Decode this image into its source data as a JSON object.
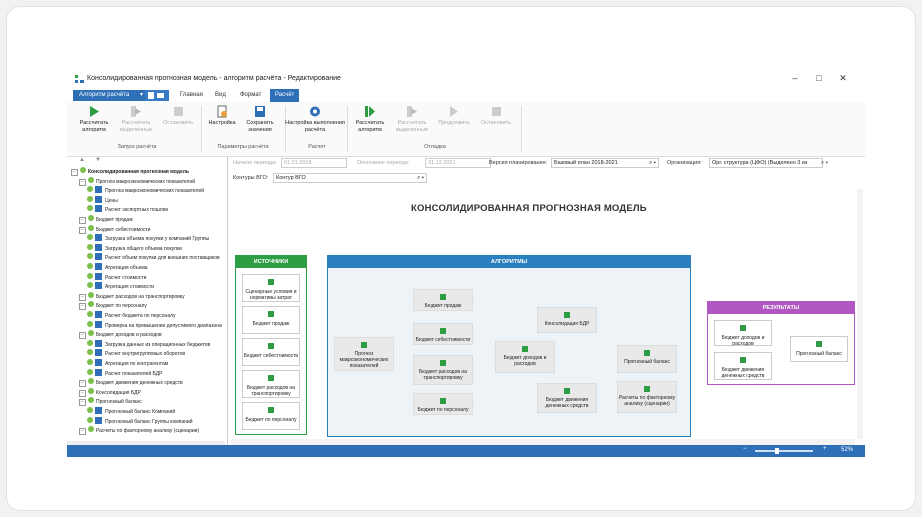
{
  "window": {
    "title": "Консолидированная прогнозная модель - алгоритм расчёта - Редактирование",
    "controls": [
      "–",
      "□",
      "✕"
    ]
  },
  "tabs": {
    "app_button": "Алгоритм расчёта",
    "items": [
      "Главная",
      "Вид",
      "Формат",
      "Расчёт"
    ],
    "active": "Расчёт"
  },
  "ribbon": {
    "buttons": [
      {
        "label": "Рассчитать алгоритм",
        "icon": "play-icon",
        "disabled": false
      },
      {
        "label": "Рассчитать выделенные",
        "icon": "play-selected-icon",
        "disabled": true
      },
      {
        "label": "Остановить",
        "icon": "stop-icon",
        "disabled": true
      },
      {
        "label": "Настройка",
        "icon": "settings-doc-icon",
        "disabled": false
      },
      {
        "label": "Сохранить значения",
        "icon": "save-icon",
        "disabled": false
      },
      {
        "label": "Настройка выполнения расчёта",
        "icon": "gear-icon",
        "disabled": false
      },
      {
        "label": "Рассчитать алгоритм",
        "icon": "play-icon",
        "disabled": false
      },
      {
        "label": "Рассчитать выделенные",
        "icon": "play-selected-icon",
        "disabled": true
      },
      {
        "label": "Продолжить",
        "icon": "continue-icon",
        "disabled": true
      },
      {
        "label": "Остановить",
        "icon": "stop-icon",
        "disabled": true
      }
    ],
    "groups": [
      "Запуск расчёта",
      "Параметры расчёта",
      "Расчет",
      "Отладка"
    ]
  },
  "tree": {
    "items": [
      {
        "label": "Консолидированная прогнозная модель",
        "level": 0
      },
      {
        "label": "Прогноз макроэкономических показателей",
        "level": 1
      },
      {
        "label": "Прогноз макроэкономических показателей",
        "level": 2
      },
      {
        "label": "Цены",
        "level": 2
      },
      {
        "label": "Расчет экспортных пошлин",
        "level": 2
      },
      {
        "label": "Бюджет продаж",
        "level": 1
      },
      {
        "label": "Бюджет себестоимости",
        "level": 1
      },
      {
        "label": "Загрузка объема покупки у компаний Группы",
        "level": 2
      },
      {
        "label": "Загрузка общего объема покупки",
        "level": 2
      },
      {
        "label": "Расчет объем покупки для внешних поставщиков",
        "level": 2
      },
      {
        "label": "Агрегация объема",
        "level": 2
      },
      {
        "label": "Расчет стоимости",
        "level": 2
      },
      {
        "label": "Агрегация стоимости",
        "level": 2
      },
      {
        "label": "Бюджет расходов на транспортировку",
        "level": 1
      },
      {
        "label": "Бюджет по персоналу",
        "level": 1
      },
      {
        "label": "Расчет бюджета по персоналу",
        "level": 2
      },
      {
        "label": "Проверка на превышение допустимого диапазона",
        "level": 2
      },
      {
        "label": "Бюджет доходов и расходов",
        "level": 1
      },
      {
        "label": "Загрузка данных из операционных бюджетов",
        "level": 2
      },
      {
        "label": "Расчет внутригрупповых оборотов",
        "level": 2
      },
      {
        "label": "Агрегация по контрагентам",
        "level": 2
      },
      {
        "label": "Расчет показателей БДР",
        "level": 2
      },
      {
        "label": "Бюджет движения денежных средств",
        "level": 1
      },
      {
        "label": "Консолидация БДР",
        "level": 1
      },
      {
        "label": "Прогнозный баланс",
        "level": 1
      },
      {
        "label": "Прогнозный баланс Компаний",
        "level": 2
      },
      {
        "label": "Прогнозный баланс Группы компаний",
        "level": 2
      },
      {
        "label": "Расчеты по факторному анализу (сценарии)",
        "level": 1
      }
    ]
  },
  "filters": {
    "period_start_label": "Начало периода:",
    "period_start_value": "01.01.2018",
    "period_end_label": "Окончание периода:",
    "period_end_value": "31.12.2021",
    "version_label": "Версия планирования:",
    "version_value": "Базовый план 2018-2021",
    "org_label": "Организация:",
    "org_value": "Орг. структура (ЦФО) (Выделено 3 из",
    "contour_label": "Контуры ВГО:",
    "contour_value": "Контур ВГО"
  },
  "diagram": {
    "title": "КОНСОЛИДИРОВАННАЯ ПРОГНОЗНАЯ МОДЕЛЬ",
    "sources_header": "ИСТОЧНИКИ",
    "sources": [
      "Сценарные условия и нормативы затрат",
      "Бюджет продаж",
      "Бюджет себестоимости",
      "Бюджет расходов на транспортировку",
      "Бюджет по персоналу"
    ],
    "algorithms_header": "АЛГОРИТМЫ",
    "algorithms": {
      "macro": "Прогноз макроэкономических показателей",
      "sales": "Бюджет продаж",
      "cost": "Бюджет себестоимости",
      "transport": "Бюджет расходов на транспортировку",
      "personnel": "Бюджет по персоналу",
      "bdr": "Бюджет доходов и расходов",
      "consolidation": "Консолидация БДР",
      "cashflow": "Бюджет движения денежных средств",
      "balance": "Прогнозный баланс",
      "factor": "Расчеты по факторному анализу (сценарии)"
    },
    "results_header": "РЕЗУЛЬТАТЫ",
    "results": {
      "bdr": "Бюджет доходов и расходов",
      "cashflow": "Бюджет движения денежных средств",
      "balance": "Прогнозный баланс"
    }
  },
  "status": {
    "zoom_minus": "−",
    "zoom_plus": "+",
    "zoom_value": "52%"
  },
  "colors": {
    "accent": "#2e6fb8",
    "sources": "#2e9e45",
    "algorithms": "#2a7fc0",
    "results": "#b057c2"
  }
}
